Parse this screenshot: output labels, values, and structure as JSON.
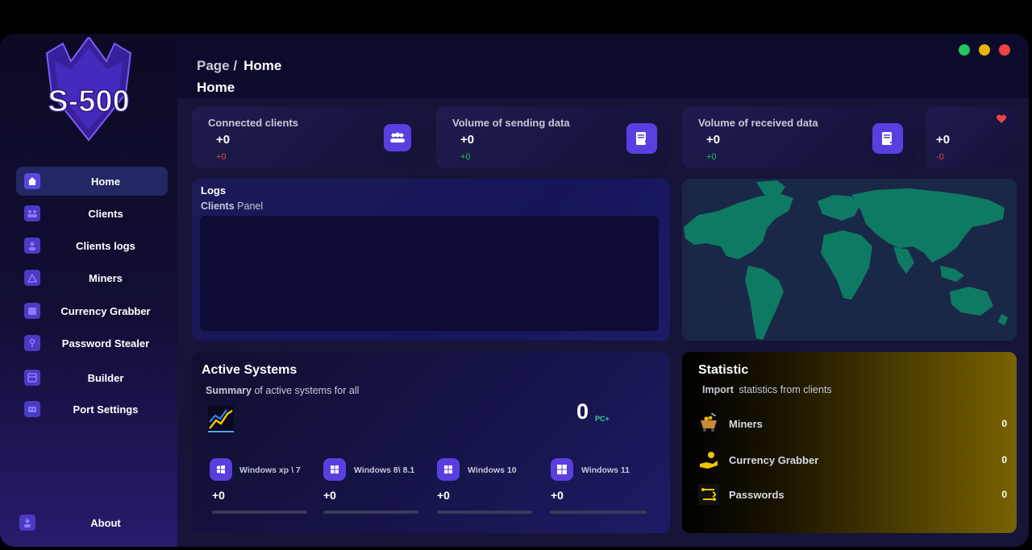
{
  "logo_text": "S-500",
  "sidebar": {
    "items": [
      {
        "label": "Home",
        "icon": "home-icon"
      },
      {
        "label": "Clients",
        "icon": "users-icon"
      },
      {
        "label": "Clients logs",
        "icon": "user-log-icon"
      },
      {
        "label": "Miners",
        "icon": "miner-icon"
      },
      {
        "label": "Currency Grabber",
        "icon": "wallet-icon"
      },
      {
        "label": "Password Stealer",
        "icon": "key-icon"
      },
      {
        "label": "Builder",
        "icon": "builder-icon"
      },
      {
        "label": "Port Settings",
        "icon": "port-icon"
      }
    ],
    "about": {
      "label": "About",
      "icon": "about-icon"
    }
  },
  "header": {
    "breadcrumb_root": "Page /",
    "breadcrumb_current": "Home",
    "title": "Home"
  },
  "window_controls": {
    "colors": [
      "#22c55e",
      "#eab308",
      "#ef4444"
    ]
  },
  "stats": [
    {
      "title": "Connected clients",
      "value": "+0",
      "delta": "+0",
      "delta_color": "#ef4444",
      "icon": "users-icon"
    },
    {
      "title": "Volume of sending data",
      "value": "+0",
      "delta": "+0",
      "delta_color": "#22c55e",
      "icon": "upload-icon"
    },
    {
      "title": "Volume of received data",
      "value": "+0",
      "delta": "+0",
      "delta_color": "#22c55e",
      "icon": "download-icon"
    },
    {
      "title": "",
      "value": "+0",
      "delta": "-0",
      "delta_color": "#ef4444",
      "icon": "heart-icon"
    }
  ],
  "logs": {
    "title": "Logs",
    "subtitle_bold": "Clients",
    "subtitle": "Panel"
  },
  "active_systems": {
    "title": "Active Systems",
    "summary_bold": "Summary",
    "summary": "of active systems for all",
    "total": "0",
    "total_unit": "PC+",
    "systems": [
      {
        "name": "Windows xp \\ 7",
        "value": "+0",
        "progress": 0
      },
      {
        "name": "Windows 8\\ 8.1",
        "value": "+0",
        "progress": 0
      },
      {
        "name": "Windows 10",
        "value": "+0",
        "progress": 0
      },
      {
        "name": "Windows 11",
        "value": "+0",
        "progress": 0
      }
    ]
  },
  "statistic": {
    "title": "Statistic",
    "import_bold": "Import",
    "import_text": "statistics from clients",
    "rows": [
      {
        "label": "Miners",
        "value": "0",
        "icon": "mining-cart-icon"
      },
      {
        "label": "Currency Grabber",
        "value": "0",
        "icon": "hand-coin-icon"
      },
      {
        "label": "Passwords",
        "value": "0",
        "icon": "password-icon"
      }
    ]
  },
  "colors": {
    "accent": "#5a3fe0",
    "map": "#0f7a63",
    "gold": "#7a6200"
  }
}
